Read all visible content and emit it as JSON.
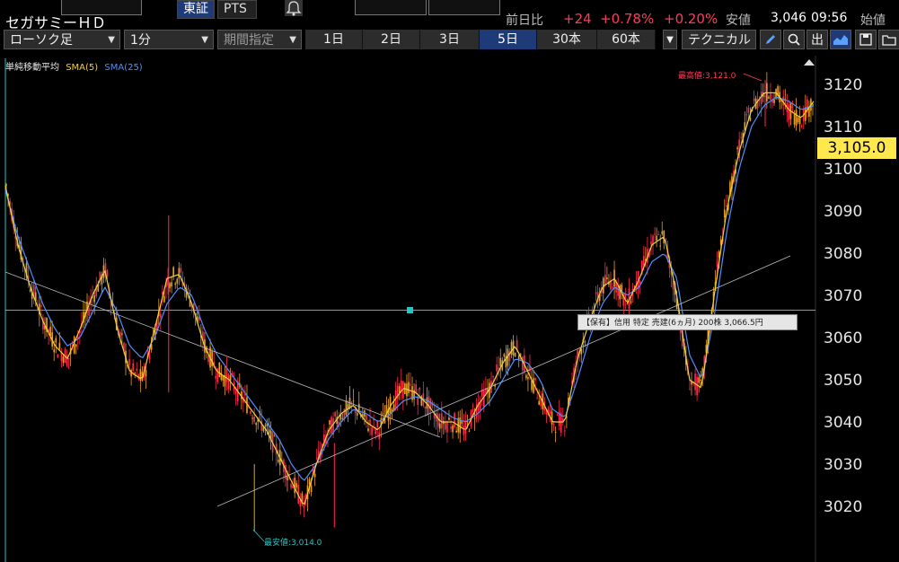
{
  "header": {
    "ticker_name": "セガサミーＨＤ",
    "venues": [
      "東証",
      "PTS"
    ],
    "change_label": "前日比",
    "change_value": "+24",
    "change_pct": "+0.78%",
    "change_pct2": "+0.20%",
    "low_label": "安値",
    "low_value": "3,046",
    "time": "09:56",
    "open_label": "始値"
  },
  "toolbar": {
    "chart_type": "ローソク足",
    "interval": "1分",
    "period": "期間指定",
    "ranges": [
      "1日",
      "2日",
      "3日",
      "5日",
      "30本",
      "60本"
    ],
    "active_range": "5日",
    "technical": "テクニカル"
  },
  "chart": {
    "legend_title": "単純移動平均",
    "sma5_label": "SMA(5)",
    "sma25_label": "SMA(25)",
    "current_price": "3,105.0",
    "max_label": "最高値:3,121.0",
    "min_label": "最安値:3,014.0",
    "position_label": "【保有】信用 特定 売建(6ヵ月) 200株 3,066.5円",
    "y_ticks": [
      "3120",
      "3110",
      "3100",
      "3090",
      "3080",
      "3070",
      "3060",
      "3050",
      "3040",
      "3030",
      "3020"
    ],
    "colors": {
      "up": "#e8a020",
      "down": "#ff2a50",
      "sma5": "#f0d040",
      "sma25": "#4f8fff",
      "hline": "#20c8c8"
    }
  },
  "chart_data": {
    "type": "line",
    "title": "",
    "xlabel": "",
    "ylabel": "",
    "ylim": [
      3011,
      3124
    ],
    "series": [
      {
        "name": "SMA(25)",
        "values": [
          3095,
          3084,
          3076,
          3068,
          3062,
          3058,
          3060,
          3066,
          3072,
          3066,
          3058,
          3055,
          3060,
          3068,
          3072,
          3070,
          3062,
          3056,
          3052,
          3048,
          3044,
          3040,
          3036,
          3030,
          3026,
          3030,
          3036,
          3040,
          3043,
          3042,
          3040,
          3042,
          3045,
          3046,
          3045,
          3043,
          3041,
          3040,
          3042,
          3045,
          3050,
          3055,
          3054,
          3050,
          3043,
          3041,
          3050,
          3060,
          3068,
          3072,
          3070,
          3072,
          3078,
          3080,
          3074,
          3056,
          3050,
          3065,
          3085,
          3100,
          3110,
          3115,
          3117,
          3116,
          3114,
          3115
        ]
      },
      {
        "name": "SMA(5)",
        "values": [
          3096,
          3082,
          3072,
          3064,
          3058,
          3055,
          3062,
          3070,
          3076,
          3062,
          3052,
          3050,
          3062,
          3074,
          3075,
          3068,
          3058,
          3052,
          3050,
          3046,
          3042,
          3038,
          3032,
          3026,
          3020,
          3030,
          3038,
          3042,
          3044,
          3040,
          3038,
          3044,
          3048,
          3047,
          3044,
          3040,
          3040,
          3038,
          3044,
          3048,
          3054,
          3058,
          3052,
          3046,
          3040,
          3040,
          3055,
          3064,
          3072,
          3074,
          3068,
          3074,
          3082,
          3084,
          3070,
          3050,
          3048,
          3070,
          3090,
          3104,
          3114,
          3118,
          3118,
          3114,
          3112,
          3116
        ]
      }
    ]
  }
}
